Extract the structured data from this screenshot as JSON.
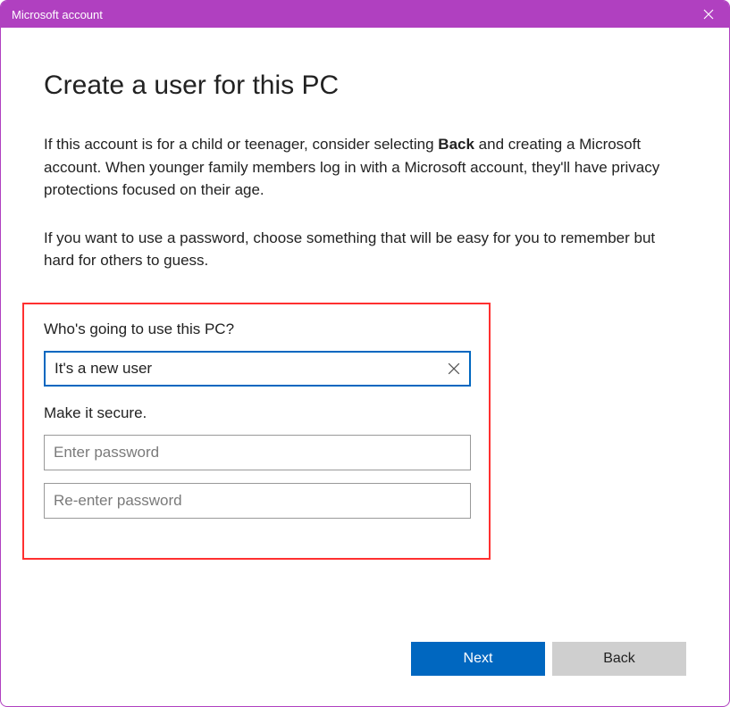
{
  "window": {
    "title": "Microsoft account"
  },
  "page": {
    "heading": "Create a user for this PC",
    "description1_pre": "If this account is for a child or teenager, consider selecting ",
    "description1_bold": "Back",
    "description1_post": " and creating a Microsoft account. When younger family members log in with a Microsoft account, they'll have privacy protections focused on their age.",
    "description2": "If you want to use a password, choose something that will be easy for you to remember but hard for others to guess."
  },
  "form": {
    "username_label": "Who's going to use this PC?",
    "username_value": "It's a new user",
    "secure_label": "Make it secure.",
    "password_placeholder": "Enter password",
    "password_confirm_placeholder": "Re-enter password"
  },
  "footer": {
    "next_label": "Next",
    "back_label": "Back"
  }
}
